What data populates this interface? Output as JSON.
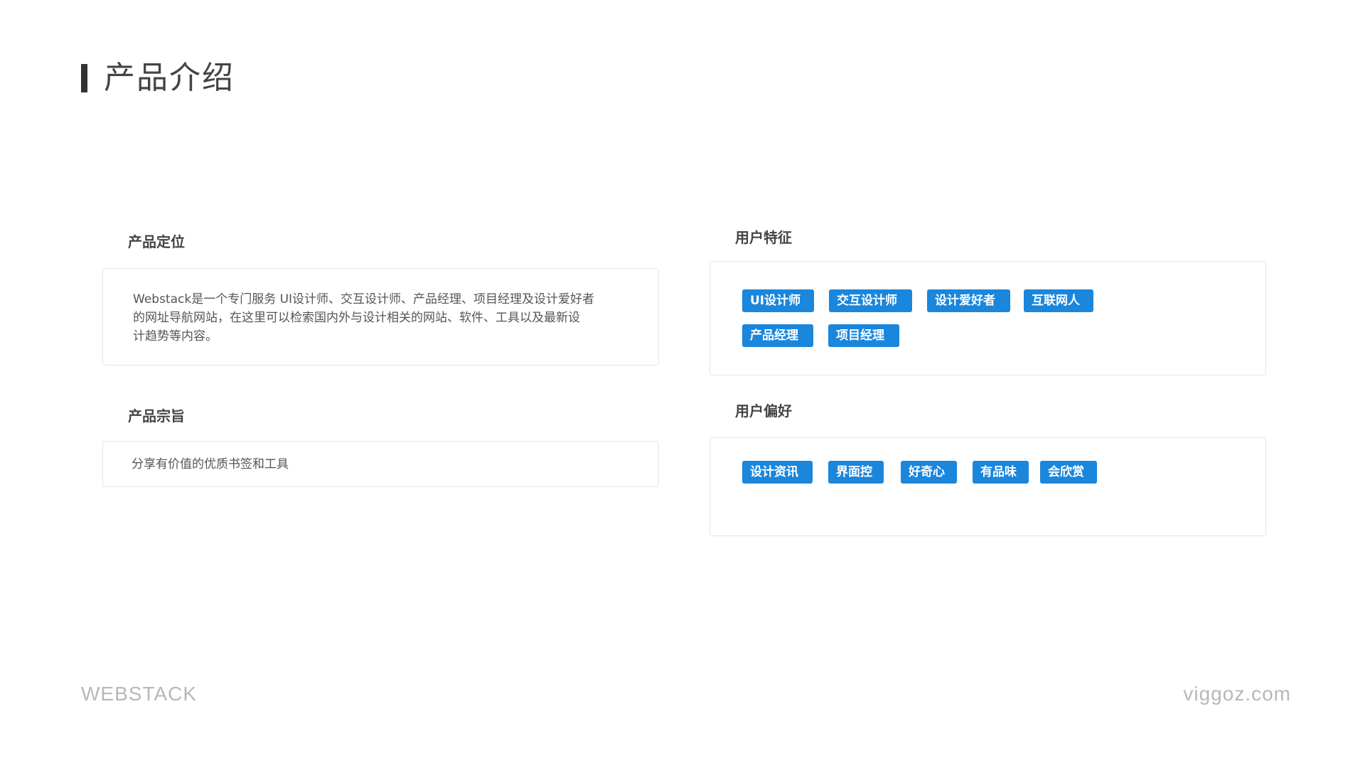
{
  "header": {
    "title": "产品介绍"
  },
  "positioning": {
    "label": "产品定位",
    "lines": [
      "Webstack是一个专门服务 UI设计师、交互设计师、产品经理、项目经理及设计爱好者",
      "的网址导航网站，在这里可以检索国内外与设计相关的网站、软件、工具以及最新设",
      "计趋势等内容。"
    ]
  },
  "purpose": {
    "label": "产品宗旨",
    "text": "分享有价值的优质书签和工具"
  },
  "user_traits": {
    "label": "用户特征",
    "tags": [
      "UI设计师",
      "交互设计师",
      "设计爱好者",
      "互联网人",
      "产品经理",
      "项目经理"
    ]
  },
  "user_preferences": {
    "label": "用户偏好",
    "tags": [
      "设计资讯",
      "界面控",
      "好奇心",
      "有品味",
      "会欣赏"
    ]
  },
  "footer": {
    "brand": "WEBSTACK",
    "site": "viggoz.com"
  },
  "colors": {
    "accent": "#1a86dc",
    "title_bar": "#333333",
    "footer_text": "#b8b8b8"
  }
}
